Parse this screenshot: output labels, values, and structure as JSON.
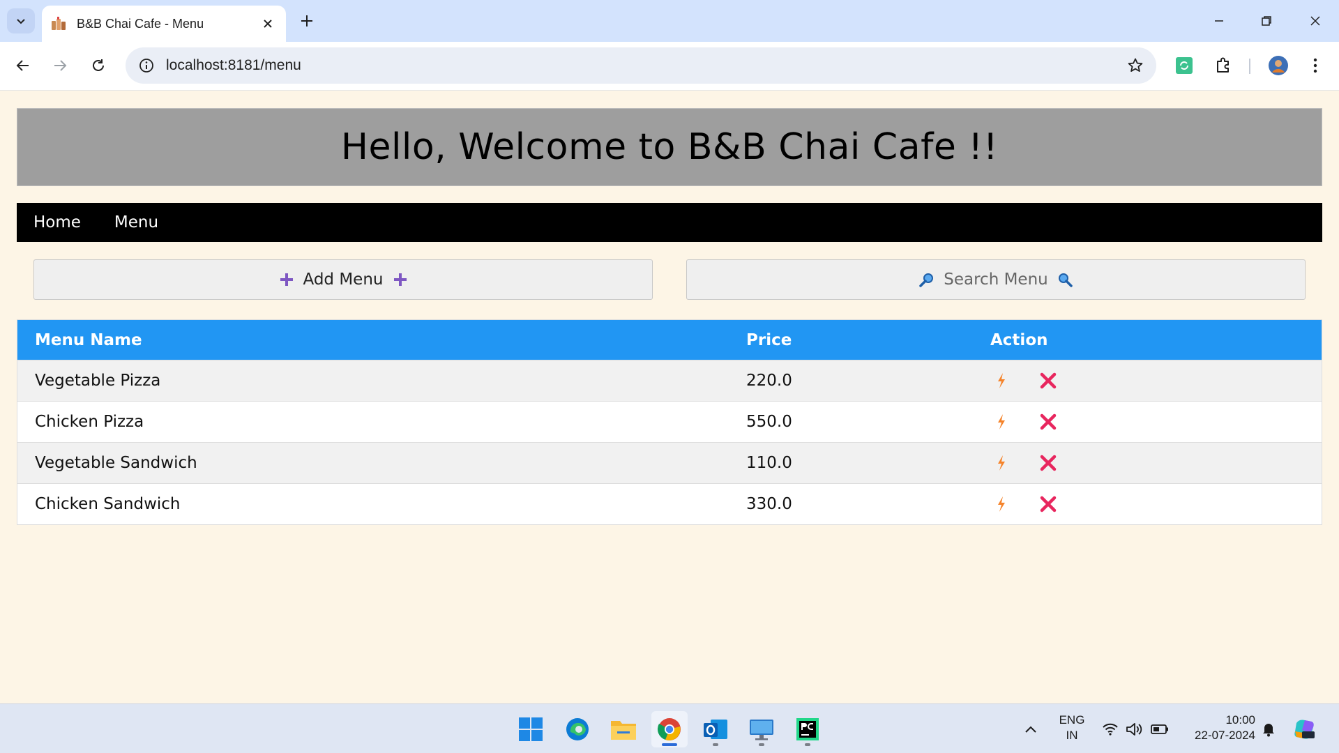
{
  "browser": {
    "tab_title": "B&B Chai Cafe - Menu",
    "url": "localhost:8181/menu"
  },
  "app": {
    "banner_title": "Hello, Welcome to B&B Chai Cafe !!",
    "nav": [
      {
        "label": "Home"
      },
      {
        "label": "Menu"
      }
    ],
    "add_button_label": "Add Menu",
    "search_button_label": "Search Menu",
    "table": {
      "columns": [
        "Menu Name",
        "Price",
        "Action"
      ],
      "rows": [
        {
          "name": "Vegetable Pizza",
          "price": "220.0"
        },
        {
          "name": "Chicken Pizza",
          "price": "550.0"
        },
        {
          "name": "Vegetable Sandwich",
          "price": "110.0"
        },
        {
          "name": "Chicken Sandwich",
          "price": "330.0"
        }
      ]
    },
    "colors": {
      "page_bg": "#fdf5e6",
      "banner_bg": "#9e9e9e",
      "nav_bg": "#000000",
      "table_header_bg": "#2196f3",
      "edit_icon": "#f5832a",
      "delete_icon": "#e8265e",
      "plus_icon": "#7e57c2"
    },
    "icons": {
      "add_left": "plus-icon",
      "add_right": "plus-icon",
      "search_left": "magnifier-right-icon",
      "search_right": "magnifier-left-icon",
      "edit": "lightning-icon",
      "delete": "cross-mark-icon"
    }
  },
  "taskbar": {
    "language_line1": "ENG",
    "language_line2": "IN",
    "time": "10:00",
    "date": "22-07-2024"
  }
}
